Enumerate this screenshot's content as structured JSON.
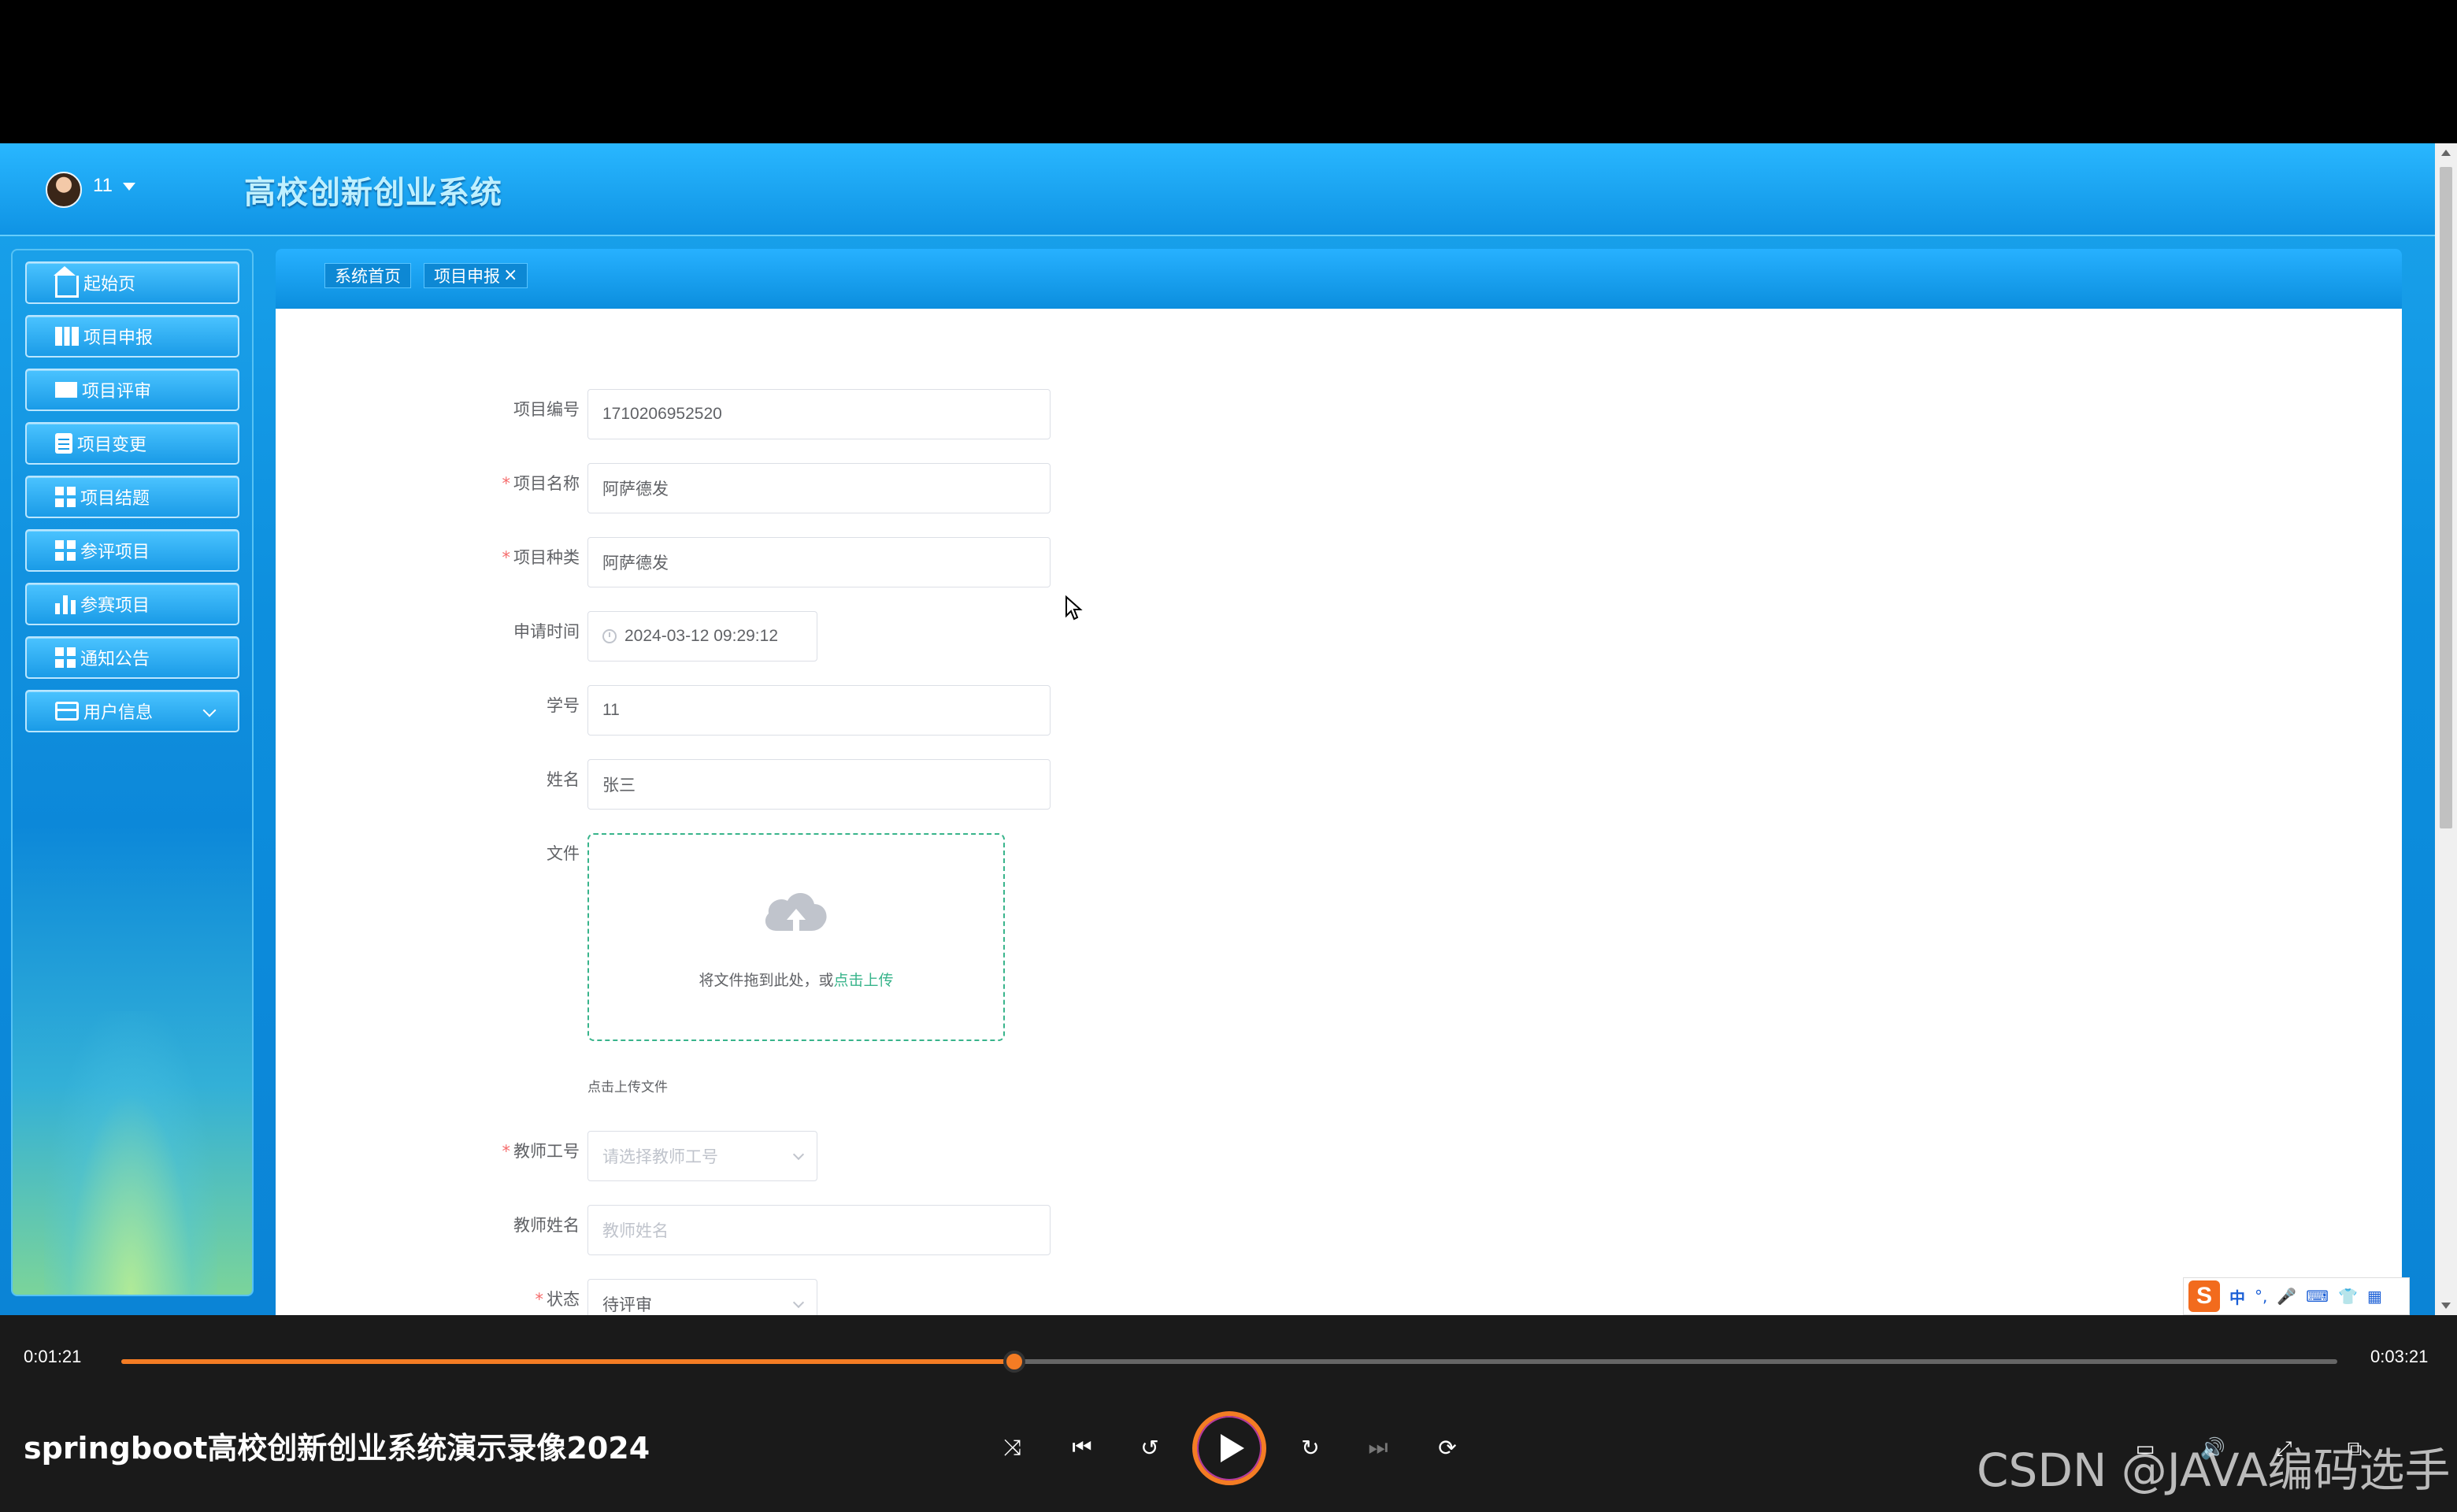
{
  "app": {
    "title": "高校创新创业系统",
    "username": "11"
  },
  "sidebar": {
    "items": [
      {
        "label": "起始页",
        "icon": "home-icon"
      },
      {
        "label": "项目申报",
        "icon": "book-icon"
      },
      {
        "label": "项目评审",
        "icon": "monitor-icon"
      },
      {
        "label": "项目变更",
        "icon": "clipboard-icon"
      },
      {
        "label": "项目结题",
        "icon": "grid-icon"
      },
      {
        "label": "参评项目",
        "icon": "grid-icon"
      },
      {
        "label": "参赛项目",
        "icon": "bar-chart-icon"
      },
      {
        "label": "通知公告",
        "icon": "grid-icon"
      },
      {
        "label": "用户信息",
        "icon": "wallet-icon"
      }
    ]
  },
  "tabs": [
    {
      "label": "系统首页"
    },
    {
      "label": "项目申报",
      "close": "×"
    }
  ],
  "form": {
    "project_no": {
      "label": "项目编号",
      "value": "1710206952520"
    },
    "project_name": {
      "label": "项目名称",
      "value": "阿萨德发",
      "required": "*"
    },
    "project_type": {
      "label": "项目种类",
      "value": "阿萨德发",
      "required": "*"
    },
    "apply_time": {
      "label": "申请时间",
      "value": "2024-03-12 09:29:12"
    },
    "student_no": {
      "label": "学号",
      "value": "11"
    },
    "name": {
      "label": "姓名",
      "value": "张三"
    },
    "file": {
      "label": "文件",
      "drop_text": "将文件拖到此处，或",
      "click_text": "点击上传",
      "tip": "点击上传文件"
    },
    "teacher_no": {
      "label": "教师工号",
      "placeholder": "请选择教师工号",
      "required": "*"
    },
    "teacher_name": {
      "label": "教师姓名",
      "placeholder": "教师姓名"
    },
    "status": {
      "label": "状态",
      "value": "待评审",
      "required": "*"
    }
  },
  "ime": {
    "zh": "中",
    "punct": "°,",
    "logo": "S"
  },
  "player": {
    "current_time": "0:01:21",
    "total_time": "0:03:21",
    "progress": 0.403,
    "video_title": "springboot高校创新创业系统演示录像2024",
    "watermark": "CSDN @JAVA编码选手"
  },
  "colors": {
    "header_blue": "#1aa3ec",
    "accent_orange": "#f47c24",
    "upload_green": "#38b48b",
    "required_red": "#f56c6c"
  }
}
